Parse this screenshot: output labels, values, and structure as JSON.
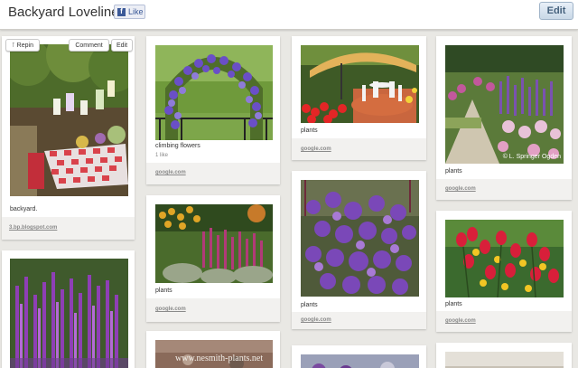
{
  "board": {
    "title": "Backyard Loveliness",
    "like_label": "Like",
    "edit_label": "Edit"
  },
  "hover_actions": {
    "repin": "Repin",
    "comment": "Comment",
    "edit": "Edit"
  },
  "pins": [
    {
      "description": "backyard.",
      "source": "3.bp.blogspot.com"
    },
    {
      "description": "climbing flowers",
      "likes": "1 like",
      "source": "google.com"
    },
    {
      "description": "plants",
      "source": "google.com"
    },
    {
      "description": "plants",
      "source": "google.com"
    },
    {
      "description": "plants",
      "source": "google.com"
    },
    {
      "description": "plants",
      "source": "google.com"
    },
    {
      "description": "plants",
      "source": "google.com"
    }
  ],
  "watermarks": {
    "pin4": "© L. Springer Ogden",
    "pin10": "www.nesmith-plants.net"
  },
  "icons": {
    "like": "facebook-icon",
    "repin": "pushpin-icon"
  }
}
